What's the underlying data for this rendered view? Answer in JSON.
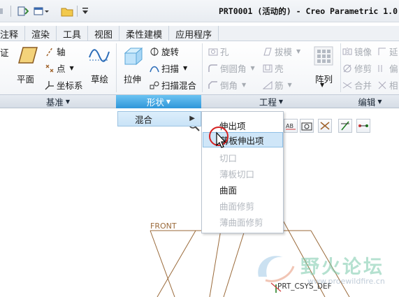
{
  "titlebar": {
    "title": "PRT0001 (活动的) - Creo Parametric 1.0"
  },
  "tabs": [
    "注释",
    "渲染",
    "工具",
    "视图",
    "柔性建模",
    "应用程序"
  ],
  "ribbon": {
    "datum": {
      "partial_left_label": "证",
      "plane_label": "平面",
      "axis_label": "轴",
      "point_label": "点",
      "csys_label": "坐标系",
      "sketch_label": "草绘"
    },
    "shapes": {
      "extrude_label": "拉伸",
      "revolve_label": "旋转",
      "sweep_label": "扫描",
      "swept_blend_label": "扫描混合"
    },
    "engineering": {
      "hole_label": "孔",
      "round_label": "倒圆角",
      "chamfer_label": "倒角",
      "draft_label": "拔模",
      "shell_label": "壳",
      "rib_label": "筋",
      "pattern_label": "阵列"
    },
    "editing": {
      "mirror_label": "镜像",
      "trim_label": "修剪",
      "merge_label": "合并",
      "partial_extend": "延",
      "partial_offset": "偏",
      "partial_intersect": "相"
    }
  },
  "groups": {
    "datum": "基准",
    "shapes": "形状",
    "engineering": "工程",
    "editing": "编辑"
  },
  "submenu": {
    "label": "混合"
  },
  "dropdown": {
    "items": [
      {
        "label": "伸出项",
        "enabled": true
      },
      {
        "label": "薄板伸出项",
        "enabled": true,
        "highlighted": true
      },
      {
        "label": "切口",
        "enabled": false
      },
      {
        "label": "薄板切口",
        "enabled": false
      },
      {
        "label": "曲面",
        "enabled": true
      },
      {
        "label": "曲面修剪",
        "enabled": false
      },
      {
        "label": "薄曲面修剪",
        "enabled": false
      }
    ]
  },
  "canvas": {
    "front_label": "FRONT",
    "csys_label": "PRT_CSYS_DEF"
  },
  "watermark": {
    "text": "野火论坛",
    "url": "www.proewildfire.cn"
  },
  "colors": {
    "accent": "#2f96d9",
    "highlight": "#cfe6f8",
    "datum_plane": "#9a6a3a"
  }
}
